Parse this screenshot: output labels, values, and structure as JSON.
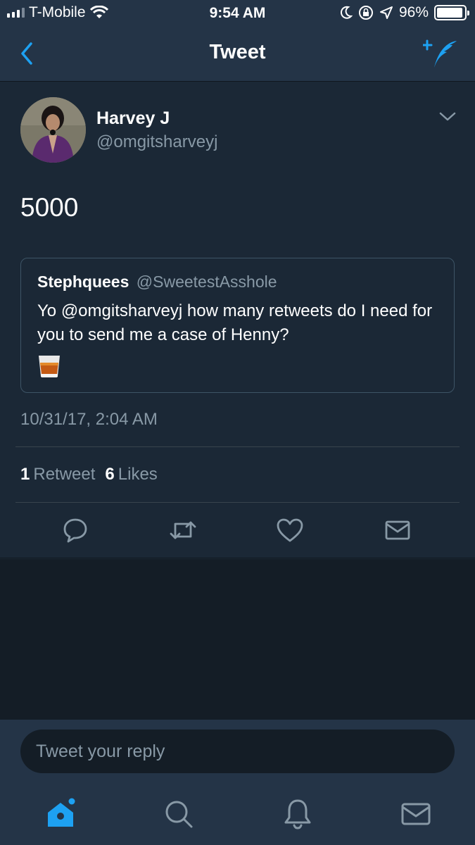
{
  "status_bar": {
    "carrier": "T-Mobile",
    "time": "9:54 AM",
    "battery": "96%"
  },
  "nav": {
    "title": "Tweet"
  },
  "tweet": {
    "author_name": "Harvey J",
    "author_handle": "@omgitsharveyj",
    "text": "5000",
    "timestamp": "10/31/17, 2:04 AM",
    "retweet_count": "1",
    "retweet_label": "Retweet",
    "like_count": "6",
    "like_label": "Likes"
  },
  "quoted_tweet": {
    "author_name": "Stephquees",
    "author_handle": "@SweetestAsshole",
    "text": "Yo @omgitsharveyj how many retweets do I need for you to send me a case of Henny?",
    "emoji": "tumbler-glass"
  },
  "reply": {
    "placeholder": "Tweet your reply"
  },
  "colors": {
    "accent": "#1da1f2",
    "background": "#1b2836",
    "bar": "#243447",
    "muted": "#8899a6"
  },
  "tabs": [
    "home",
    "search",
    "notifications",
    "messages"
  ]
}
